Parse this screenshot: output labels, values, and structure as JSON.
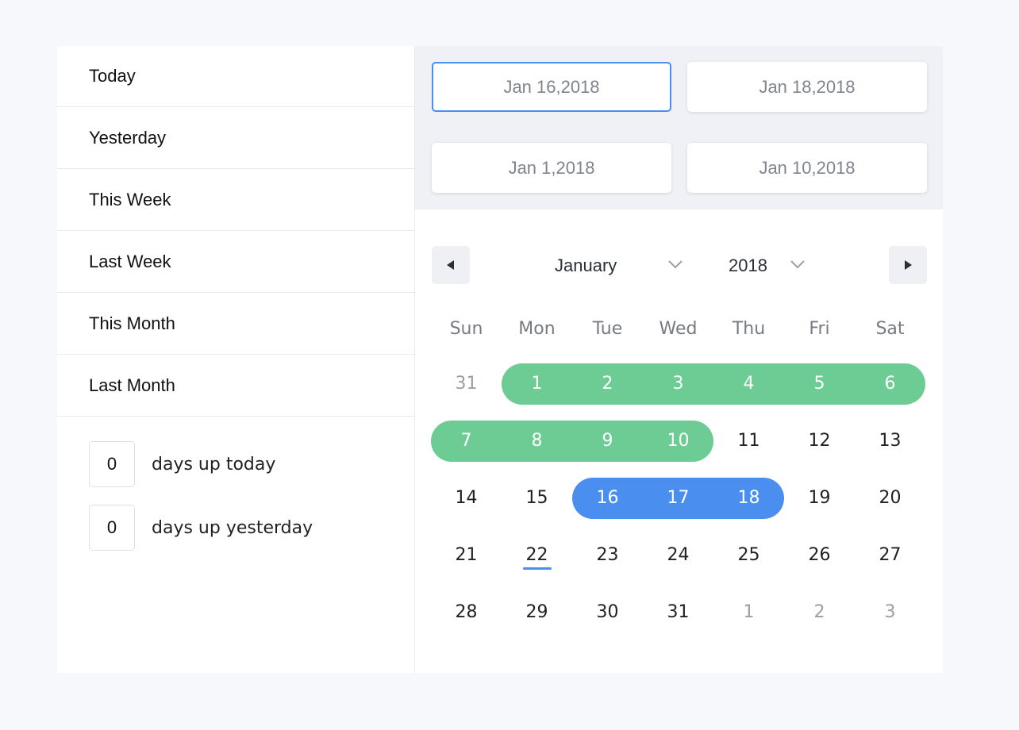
{
  "presets": [
    "Today",
    "Yesterday",
    "This Week",
    "Last Week",
    "This Month",
    "Last Month"
  ],
  "days_up": [
    {
      "value": "0",
      "label": "days up today"
    },
    {
      "value": "0",
      "label": "days up yesterday"
    }
  ],
  "date_fields": [
    "Jan 16,2018",
    "Jan 18,2018",
    "Jan 1,2018",
    "Jan 10,2018"
  ],
  "calendar": {
    "month": "January",
    "year": "2018",
    "weekdays": [
      "Sun",
      "Mon",
      "Tue",
      "Wed",
      "Thu",
      "Fri",
      "Sat"
    ],
    "weeks": [
      [
        "31",
        "1",
        "2",
        "3",
        "4",
        "5",
        "6"
      ],
      [
        "7",
        "8",
        "9",
        "10",
        "11",
        "12",
        "13"
      ],
      [
        "14",
        "15",
        "16",
        "17",
        "18",
        "19",
        "20"
      ],
      [
        "21",
        "22",
        "23",
        "24",
        "25",
        "26",
        "27"
      ],
      [
        "28",
        "29",
        "30",
        "31",
        "1",
        "2",
        "3"
      ]
    ],
    "muted_cells": [
      "0-0",
      "4-4",
      "4-5",
      "4-6"
    ],
    "today": "22",
    "ranges": [
      {
        "color": "#6ccc93",
        "start": "1",
        "end": "10"
      },
      {
        "color": "#4a8ef0",
        "start": "16",
        "end": "18"
      }
    ]
  },
  "colors": {
    "accent": "#4a8ef0",
    "green": "#6ccc93"
  },
  "icons": {
    "prev": "caret-left-icon",
    "next": "caret-right-icon",
    "dropdown": "chevron-down-icon"
  }
}
